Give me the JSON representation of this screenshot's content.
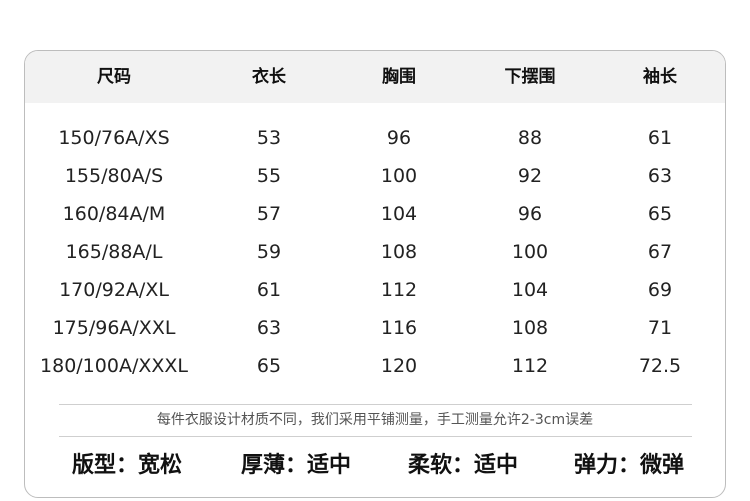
{
  "table": {
    "headers": [
      "尺码",
      "衣长",
      "胸围",
      "下摆围",
      "袖长"
    ],
    "rows": [
      [
        "150/76A/XS",
        "53",
        "96",
        "88",
        "61"
      ],
      [
        "155/80A/S",
        "55",
        "100",
        "92",
        "63"
      ],
      [
        "160/84A/M",
        "57",
        "104",
        "96",
        "65"
      ],
      [
        "165/88A/L",
        "59",
        "108",
        "100",
        "67"
      ],
      [
        "170/92A/XL",
        "61",
        "112",
        "104",
        "69"
      ],
      [
        "175/96A/XXL",
        "63",
        "116",
        "108",
        "71"
      ],
      [
        "180/100A/XXXL",
        "65",
        "120",
        "112",
        "72.5"
      ]
    ]
  },
  "note": "每件衣服设计材质不同，我们采用平铺测量，手工测量允许2-3cm误差",
  "attributes": [
    "版型：宽松",
    "厚薄：适中",
    "柔软：适中",
    "弹力：微弹"
  ],
  "colors": {
    "header_bg": "#f2f2f2",
    "border": "#bdbdbd",
    "divider": "#cfcfcf",
    "note_text": "#555555"
  }
}
